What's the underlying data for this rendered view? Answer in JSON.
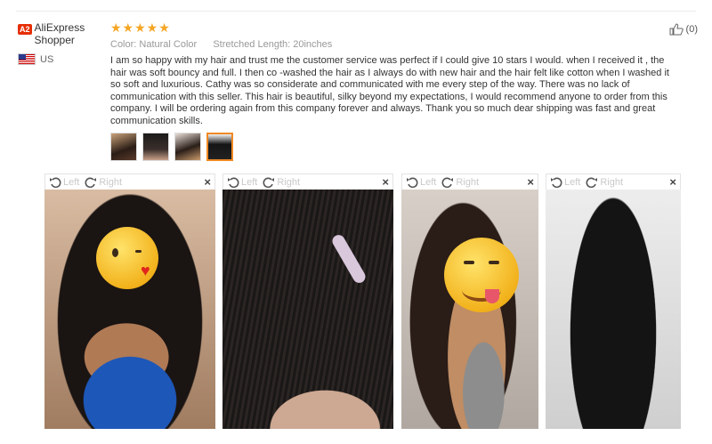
{
  "reviewer": {
    "badge": "A2",
    "name": "AliExpress Shopper",
    "country": "US"
  },
  "review": {
    "stars": "★★★★★",
    "rating": 5,
    "color_label": "Color:",
    "color_value": "Natural Color",
    "length_label": "Stretched Length:",
    "length_value": "20inches",
    "text": "I am so happy with my hair and trust me the customer service was perfect if I could give 10 stars I would. when I received it , the hair was soft bouncy and full. I then co -washed the hair as I always do with new hair and the hair felt like cotton when I washed it so soft and luxurious. Cathy was so considerate and communicated with me every step of the way. There was no lack of communication with this seller. This hair is beautiful, silky beyond my expectations, I would recommend anyone to order from this company. I will be ordering again from this company forever and always. Thank you so much dear shipping was fast and great communication skills."
  },
  "helpful": {
    "count": "(0)"
  },
  "viewer": {
    "left_label": "Left",
    "right_label": "Right",
    "close_label": "×"
  },
  "colors": {
    "stars": "#f5a623",
    "badge": "#e62e04",
    "selected_thumb": "#f08a24"
  }
}
